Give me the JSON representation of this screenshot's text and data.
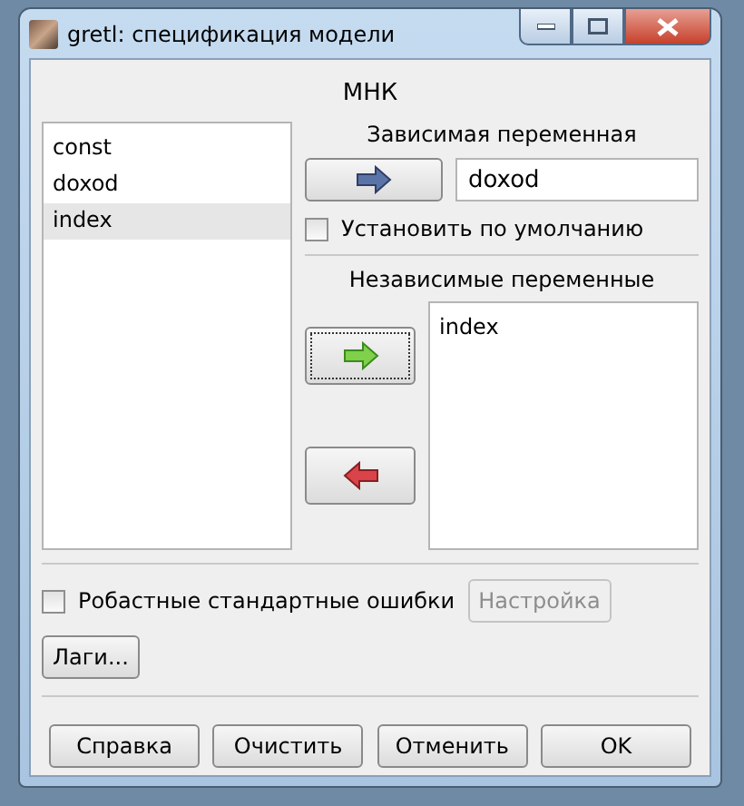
{
  "window": {
    "title": "gretl: спецификация модели"
  },
  "heading": "МНК",
  "variables": [
    {
      "name": "const",
      "selected": false
    },
    {
      "name": "doxod",
      "selected": false
    },
    {
      "name": "index",
      "selected": true
    }
  ],
  "dependent": {
    "label": "Зависимая переменная",
    "value": "doxod",
    "set_default": {
      "label": "Установить по умолчанию",
      "checked": false
    }
  },
  "independent": {
    "label": "Независимые переменные",
    "items": [
      "index"
    ]
  },
  "robust": {
    "label": "Робастные стандартные ошибки",
    "checked": false,
    "settings": {
      "label": "Настройка",
      "disabled": true
    }
  },
  "lags_button": "Лаги...",
  "buttons": [
    "Справка",
    "Очистить",
    "Отменить",
    "OK"
  ]
}
